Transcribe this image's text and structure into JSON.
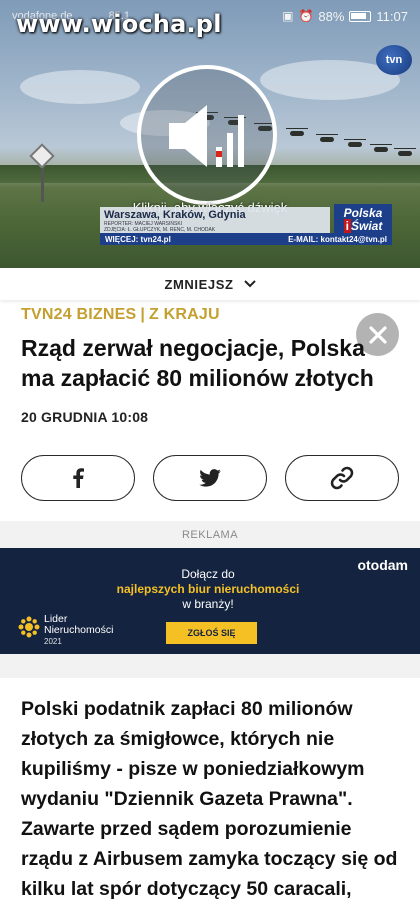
{
  "status_bar": {
    "carrier": "vodafone.de",
    "signal_text": "85.1",
    "battery": "88%",
    "time": "11:07"
  },
  "watermark": "www.wiocha.pl",
  "video": {
    "channel_logo": "tvn",
    "sound_hint": "Kliknij, aby włączyć dźwięk",
    "sound_icon": "speaker-icon",
    "tv_location": "Warszawa, Kraków, Gdynia",
    "tv_reporter": "REPORTER: MACIEJ WARSIŃSKI",
    "tv_photos": "ZDJĘCIA: Ł. GŁUPCZYK, M. RENC, M. CHODAK",
    "tv_show_line1": "Polska",
    "tv_show_i": "i",
    "tv_show_line2": "Świat",
    "tv_more": "WIĘCEJ: tvn24.pl",
    "tv_email": "E-MAIL: kontakt24@tvn.pl"
  },
  "collapse": {
    "label": "ZMNIEJSZ",
    "icon": "chevron-down-icon"
  },
  "article": {
    "category_main": "TVN24 BIZNES",
    "category_separator": "|",
    "category_sub": "Z KRAJU",
    "headline": "Rząd zerwał negocjacje, Polska ma zapłacić 80 milionów złotych",
    "date": "20 GRUDNIA 10:08",
    "close_icon": "close-icon",
    "share_buttons": [
      "facebook-icon",
      "twitter-icon",
      "link-icon"
    ],
    "body": "Polski podatnik zapłaci 80 milionów złotych za śmigłowce, których nie kupiliśmy - pisze w poniedziałkowym wydaniu \"Dziennik Gazeta Prawna\". Zawarte przed sądem porozumienie rządu z Airbusem zamyka toczący się od kilku lat spór dotyczący 50 caracali,"
  },
  "ad": {
    "label": "REKLAMA",
    "brand": "otodam",
    "line1": "Dołącz do",
    "highlight": "najlepszych biur nieruchomości",
    "line3": "w branży!",
    "cta": "ZGŁOŚ SIĘ",
    "award_line1": "Lider",
    "award_line2": "Nieruchomości",
    "award_year": "2021",
    "colors": {
      "background": "#142340",
      "accent": "#f5c023"
    }
  },
  "colors": {
    "category": "#c4a030",
    "text": "#111111"
  }
}
